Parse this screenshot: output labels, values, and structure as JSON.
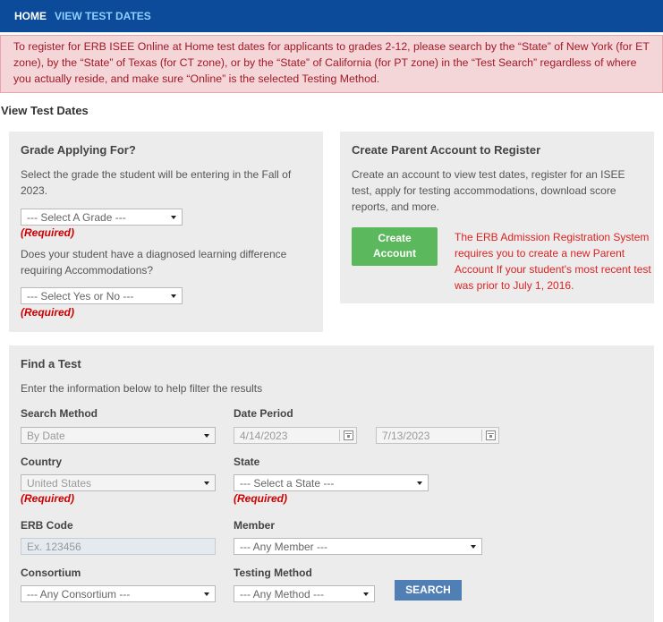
{
  "nav": {
    "home": "HOME",
    "view_test_dates": "VIEW TEST DATES"
  },
  "alert": {
    "text": "To register for ERB ISEE Online at Home test dates for applicants to grades 2-12, please search by the “State” of New York (for ET zone), by the “State” of Texas (for CT zone), or by the “State” of California (for PT zone) in the “Test Search” regardless of where you actually reside, and make sure “Online” is the selected Testing Method."
  },
  "page_title": "View Test Dates",
  "grade_panel": {
    "title": "Grade Applying For?",
    "grade_help": "Select the grade the student will be entering in the Fall of 2023.",
    "grade_select": "--- Select A Grade ---",
    "required": "(Required)",
    "accom_question": "Does your student have a diagnosed learning difference requiring Accommodations?",
    "accom_select": "--- Select Yes or No ---"
  },
  "parent_panel": {
    "title": "Create Parent Account to Register",
    "description": "Create an account to view test dates, register for an ISEE test, apply for testing accommodations, download score reports, and more.",
    "button_line1": "Create",
    "button_line2": "Account",
    "notice": "The ERB Admission Registration System requires you to create a new Parent Account If your student's most recent test was prior to July 1, 2016."
  },
  "find_panel": {
    "title": "Find a Test",
    "subtitle": "Enter the information below to help filter the results",
    "required": "(Required)",
    "search_method": {
      "label": "Search Method",
      "value": "By Date"
    },
    "date_period": {
      "label": "Date Period",
      "start": "4/14/2023",
      "end": "7/13/2023"
    },
    "country": {
      "label": "Country",
      "value": "United States"
    },
    "state": {
      "label": "State",
      "value": "--- Select a State ---"
    },
    "erb_code": {
      "label": "ERB Code",
      "placeholder": "Ex. 123456"
    },
    "member": {
      "label": "Member",
      "value": "--- Any Member ---"
    },
    "consortium": {
      "label": "Consortium",
      "value": "--- Any Consortium ---"
    },
    "testing_method": {
      "label": "Testing Method",
      "value": "--- Any Method ---"
    },
    "search_button": "SEARCH"
  },
  "colors": {
    "nav_bg": "#0c4a9a",
    "alert_bg": "#f4d5d8",
    "alert_text": "#a11a26",
    "panel_bg": "#ececec",
    "required": "#cc0000",
    "create_button": "#5cb85c",
    "search_button": "#4f7fb5"
  },
  "icons": [
    "caret-down-icon",
    "calendar-icon"
  ]
}
